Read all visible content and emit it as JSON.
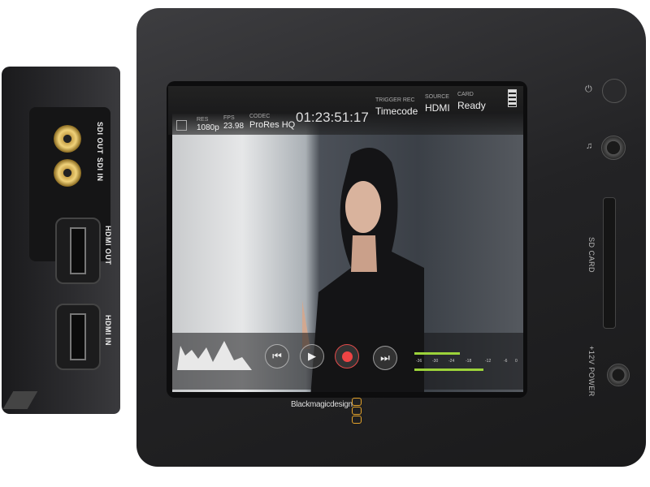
{
  "side_panel": {
    "labels": [
      "SDI OUT",
      "SDI IN",
      "HDMI OUT",
      "HDMI IN"
    ]
  },
  "status_bar": {
    "res": {
      "label": "RES",
      "value": "1080p"
    },
    "fps": {
      "label": "FPS",
      "value": "23.98"
    },
    "codec": {
      "label": "CODEC",
      "value": "ProRes HQ"
    },
    "timecode": "01:23:51:17",
    "trigger": {
      "label": "TRIGGER REC",
      "value": "Timecode"
    },
    "source": {
      "label": "SOURCE",
      "value": "HDMI"
    },
    "card": {
      "label": "CARD",
      "value": "Ready"
    }
  },
  "transport": {
    "icons": [
      "skip-back-icon",
      "play-icon",
      "record-icon",
      "skip-forward-icon"
    ]
  },
  "audio_meter": {
    "ticks": [
      "-36",
      "-30",
      "-24",
      "-18",
      "-12",
      "-6",
      "0"
    ],
    "levels": [
      0.43,
      0.65
    ],
    "color": "#9cd33a"
  },
  "brand": {
    "logo": "Blackmagicdesign",
    "accent": "#e3a22a"
  },
  "right_panel": {
    "labels": [
      "SD CARD",
      "+12V POWER"
    ]
  }
}
